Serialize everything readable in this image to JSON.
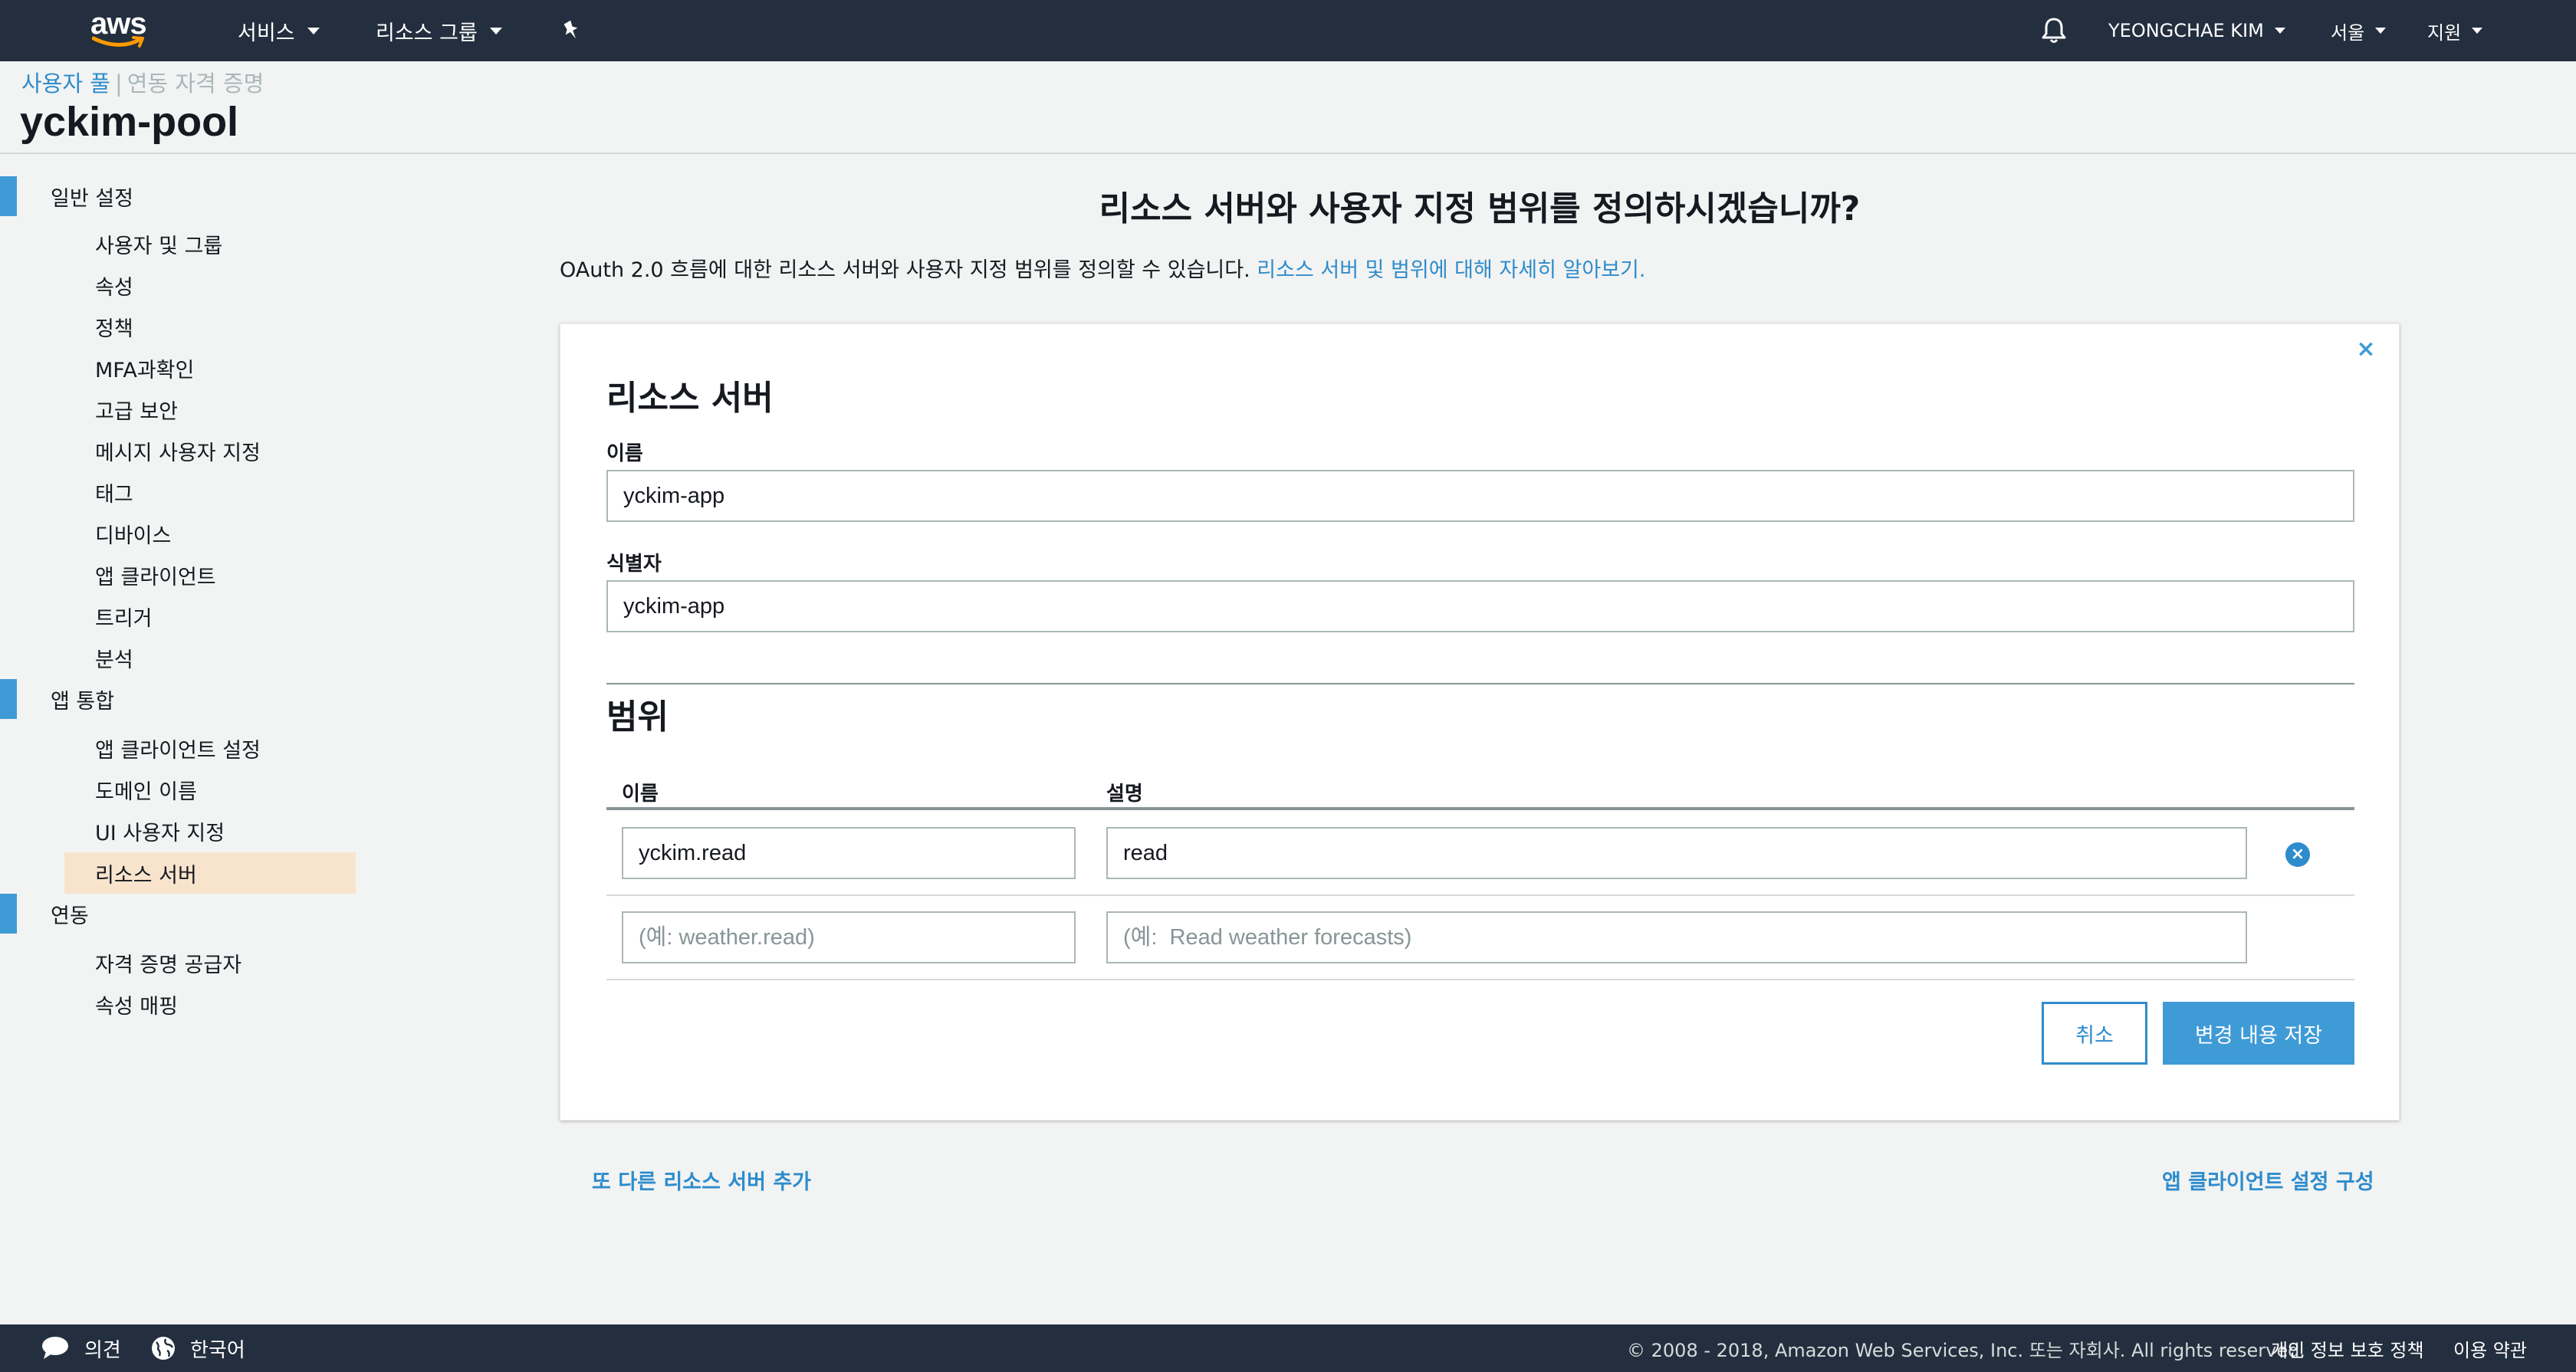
{
  "nav": {
    "logo_text": "aws",
    "services": "서비스",
    "resource_groups": "리소스 그룹",
    "user": "YEONGCHAE KIM",
    "region": "서울",
    "support": "지원"
  },
  "breadcrumb": {
    "user_pool": "사용자 풀",
    "separator": "|",
    "federated_identities": "연동 자격 증명"
  },
  "pool_name": "yckim-pool",
  "sidebar": {
    "sections": [
      {
        "label": "일반 설정",
        "items": [
          "사용자 및 그룹",
          "속성",
          "정책",
          "MFA과확인",
          "고급 보안",
          "메시지 사용자 지정",
          "태그",
          "디바이스",
          "앱 클라이언트",
          "트리거",
          "분석"
        ]
      },
      {
        "label": "앱 통합",
        "items": [
          "앱 클라이언트 설정",
          "도메인 이름",
          "UI 사용자 지정",
          "리소스 서버"
        ]
      },
      {
        "label": "연동",
        "items": [
          "자격 증명 공급자",
          "속성 매핑"
        ]
      }
    ],
    "active_item": "리소스 서버"
  },
  "main": {
    "title": "리소스 서버와 사용자 지정 범위를 정의하시겠습니까?",
    "description": "OAuth 2.0 흐름에 대한 리소스 서버와 사용자 지정 범위를 정의할 수 있습니다.",
    "learn_more_link": "리소스 서버 및 범위에 대해 자세히 알아보기."
  },
  "resource_server": {
    "heading": "리소스 서버",
    "close_icon": "×",
    "name_label": "이름",
    "name_value": "yckim-app",
    "identifier_label": "식별자",
    "identifier_value": "yckim-app"
  },
  "scopes": {
    "heading": "범위",
    "col_name": "이름",
    "col_description": "설명",
    "rows": [
      {
        "name": "yckim.read",
        "description": "read"
      }
    ],
    "new_row": {
      "name_placeholder": "(예: weather.read)",
      "description_placeholder": "(예:  Read weather forecasts)"
    },
    "remove_icon": "×"
  },
  "buttons": {
    "cancel": "취소",
    "save": "변경 내용 저장"
  },
  "links": {
    "add_another": "또 다른 리소스 서버 추가",
    "configure_app_client": "앱 클라이언트 설정 구성"
  },
  "footer": {
    "feedback": "의견",
    "language": "한국어",
    "copyright": "© 2008 - 2018, Amazon Web Services, Inc. 또는 자회사. All rights reserved.",
    "privacy": "개인 정보 보호 정책",
    "terms": "이용 약관"
  },
  "colors": {
    "nav_bg": "#232f3e",
    "accent_blue": "#3f9bd6",
    "link_blue": "#2e8ccc",
    "active_item_bg": "#f8e4cd",
    "page_bg": "#f2f3f3",
    "aws_smile": "#ff9900"
  }
}
